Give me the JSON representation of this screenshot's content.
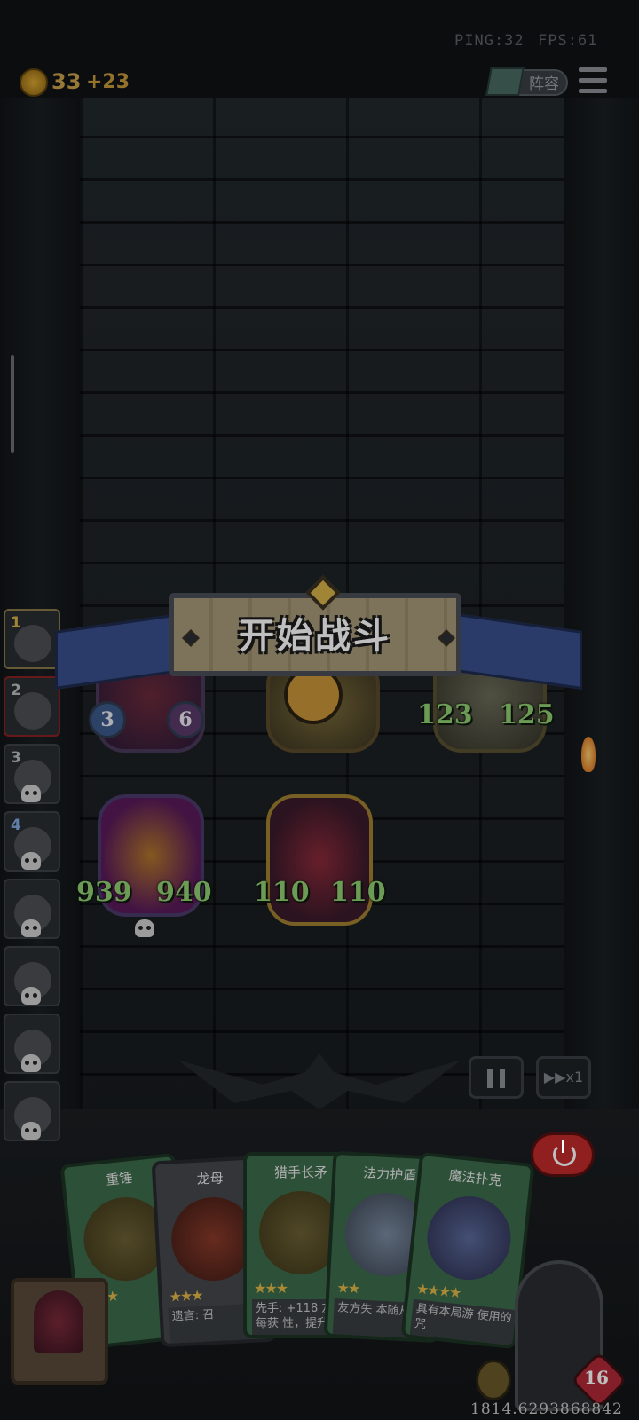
{
  "hud": {
    "ping": "PING:32",
    "fps": "FPS:61"
  },
  "gold": {
    "amount": "33",
    "income": "+23"
  },
  "lineup_label": "阵容",
  "banner": {
    "title": "开始战斗"
  },
  "queue": [
    {
      "index": "1"
    },
    {
      "index": "2"
    },
    {
      "index": "3"
    },
    {
      "index": "4"
    }
  ],
  "units": {
    "enemy_left": {
      "left": "3",
      "right": "6"
    },
    "enemy_right": {
      "attack": "123",
      "health": "125"
    },
    "ally_dragon": {
      "attack": "939",
      "health": "940"
    },
    "ally_clown": {
      "attack": "110",
      "health": "110"
    }
  },
  "speed_label": "x1",
  "cards": [
    {
      "name": "重锤",
      "desc": ""
    },
    {
      "name": "龙母",
      "desc": "遗言: 召"
    },
    {
      "name": "猎手长矛",
      "desc": "先手: +118 友方每获 性，提升"
    },
    {
      "name": "法力护盾",
      "desc": "友方失 本随从"
    },
    {
      "name": "魔法扑克",
      "desc": "具有本局游 使用的咒"
    }
  ],
  "player": {
    "health": "16"
  },
  "coordinate_text": "1814.6293868842",
  "colors": {
    "accent_gold": "#c9a24a",
    "stat_green": "#8fcf72",
    "power_red": "#c02a2a"
  }
}
